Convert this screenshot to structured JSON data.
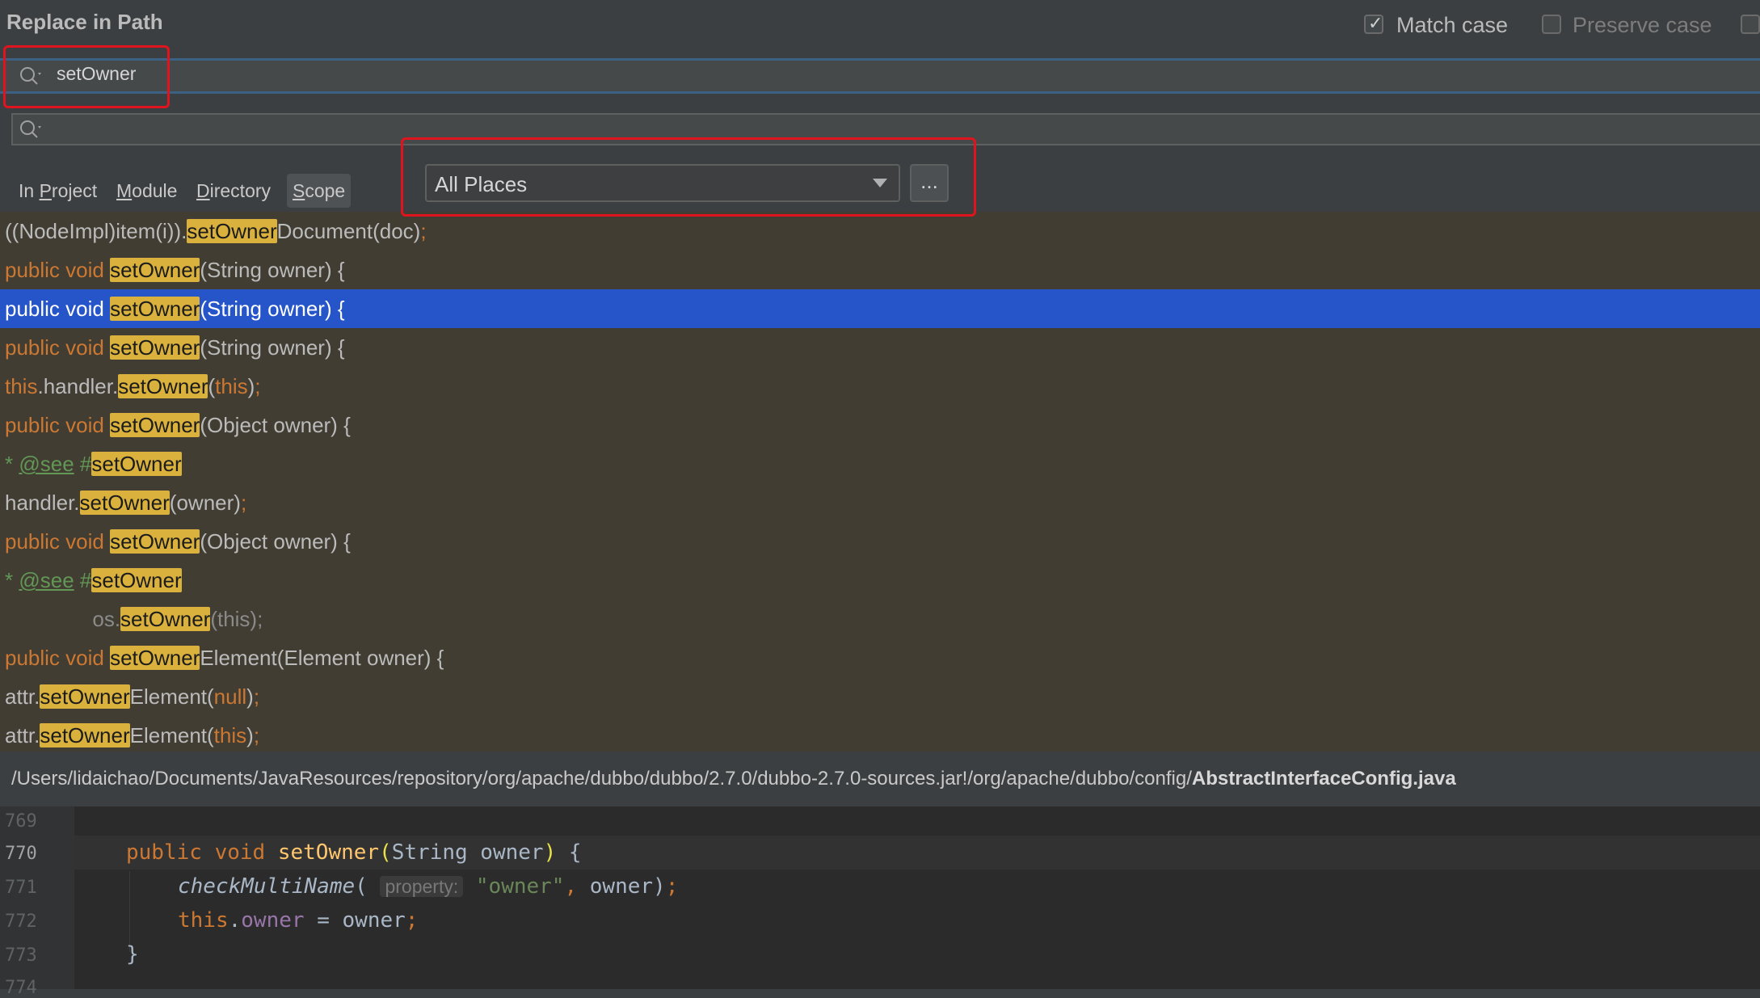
{
  "dialog": {
    "title": "Replace in Path",
    "match_case_label": "Match case",
    "preserve_case_label": "Preserve case",
    "match_case_checked": true,
    "preserve_case_checked": false
  },
  "search": {
    "find_value": "setOwner",
    "replace_value": ""
  },
  "scope_tabs": [
    {
      "label": "In Project",
      "mnemonic": "P",
      "active": false
    },
    {
      "label": "Module",
      "mnemonic": "M",
      "active": false
    },
    {
      "label": "Directory",
      "mnemonic": "D",
      "active": false
    },
    {
      "label": "Scope",
      "mnemonic": "S",
      "active": true
    }
  ],
  "scope_select": {
    "value": "All Places",
    "more_label": "..."
  },
  "results": [
    {
      "text": "((NodeImpl)item(i)).setOwnerDocument(doc);"
    },
    {
      "text": "public void setOwner(String owner) {"
    },
    {
      "text": "public void setOwner(String owner) {",
      "selected": true
    },
    {
      "text": "public void setOwner(String owner) {"
    },
    {
      "text": "this.handler.setOwner(this);"
    },
    {
      "text": "public void setOwner(Object owner) {"
    },
    {
      "text": "* @see #setOwner"
    },
    {
      "text": "handler.setOwner(owner);"
    },
    {
      "text": "public void setOwner(Object owner) {"
    },
    {
      "text": "* @see #setOwner"
    },
    {
      "text": "os.setOwner(this);"
    },
    {
      "text": "public void setOwnerElement(Element owner) {"
    },
    {
      "text": "attr.setOwnerElement(null);"
    },
    {
      "text": "attr.setOwnerElement(this);"
    }
  ],
  "file_path": {
    "dir": "/Users/lidaichao/Documents/JavaResources/repository/org/apache/dubbo/dubbo/2.7.0/dubbo-2.7.0-sources.jar!/org/apache/dubbo/config/",
    "file": "AbstractInterfaceConfig.java"
  },
  "preview": {
    "line_numbers": [
      "769",
      "770",
      "771",
      "772",
      "773"
    ],
    "current_line": "770",
    "param_hint": "property:",
    "string_literal": "\"owner\""
  },
  "colors": {
    "selection": "#2555c8",
    "match_highlight": "#d9b13c",
    "annotation_red": "#e0141e",
    "keyword": "#cc7832"
  },
  "icons": [
    "search-icon",
    "search-icon",
    "chevron-down-icon",
    "checkbox-icon"
  ]
}
